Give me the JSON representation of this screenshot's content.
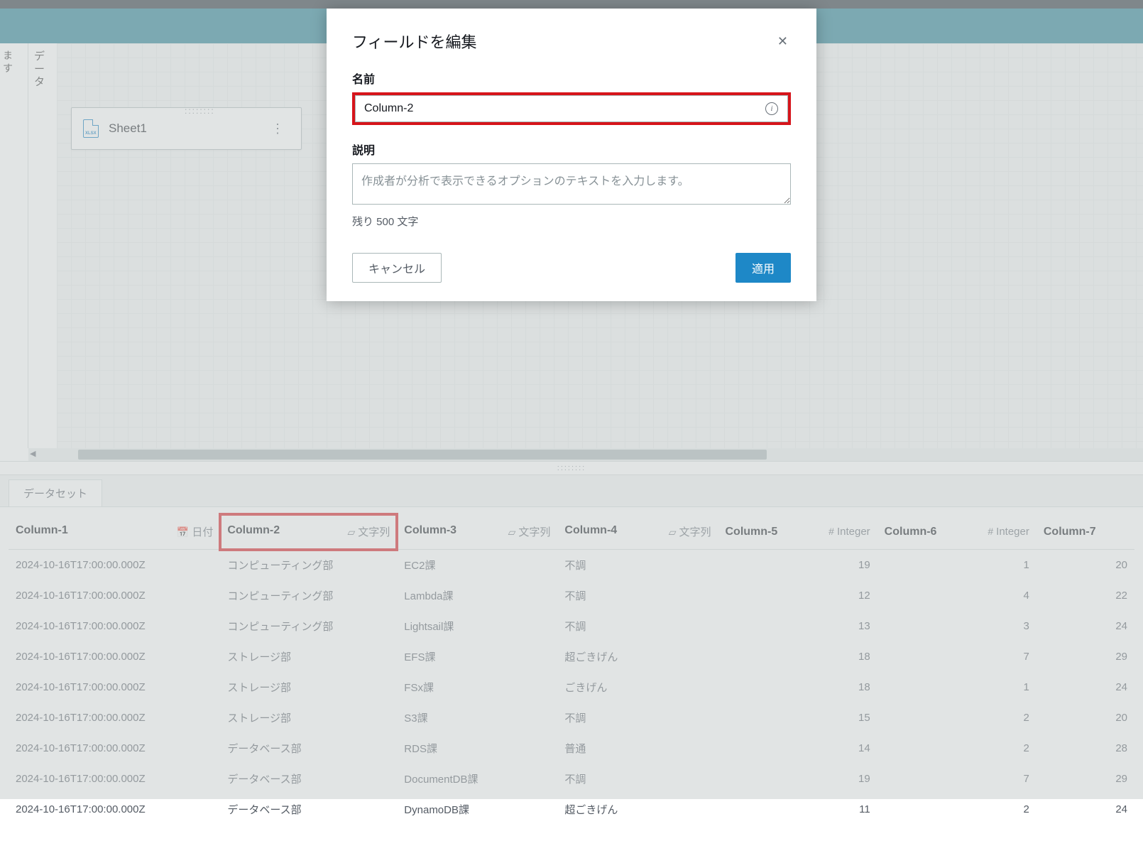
{
  "sidebar_label_ma": "ま\nす",
  "sidebar_label_data": "デー\nタ",
  "sheet": {
    "name": "Sheet1"
  },
  "tab": {
    "dataset": "データセット"
  },
  "columns": [
    {
      "name": "Column-1",
      "type_label": "日付",
      "icon": "cal"
    },
    {
      "name": "Column-2",
      "type_label": "文字列",
      "icon": "str",
      "highlight": true
    },
    {
      "name": "Column-3",
      "type_label": "文字列",
      "icon": "str"
    },
    {
      "name": "Column-4",
      "type_label": "文字列",
      "icon": "str"
    },
    {
      "name": "Column-5",
      "type_label": "Integer",
      "icon": "int"
    },
    {
      "name": "Column-6",
      "type_label": "Integer",
      "icon": "int"
    },
    {
      "name": "Column-7",
      "type_label": "",
      "icon": ""
    }
  ],
  "rows": [
    [
      "2024-10-16T17:00:00.000Z",
      "コンピューティング部",
      "EC2課",
      "不調",
      "19",
      "1",
      "20"
    ],
    [
      "2024-10-16T17:00:00.000Z",
      "コンピューティング部",
      "Lambda課",
      "不調",
      "12",
      "4",
      "22"
    ],
    [
      "2024-10-16T17:00:00.000Z",
      "コンピューティング部",
      "Lightsail課",
      "不調",
      "13",
      "3",
      "24"
    ],
    [
      "2024-10-16T17:00:00.000Z",
      "ストレージ部",
      "EFS課",
      "超ごきげん",
      "18",
      "7",
      "29"
    ],
    [
      "2024-10-16T17:00:00.000Z",
      "ストレージ部",
      "FSx課",
      "ごきげん",
      "18",
      "1",
      "24"
    ],
    [
      "2024-10-16T17:00:00.000Z",
      "ストレージ部",
      "S3課",
      "不調",
      "15",
      "2",
      "20"
    ],
    [
      "2024-10-16T17:00:00.000Z",
      "データベース部",
      "RDS課",
      "普通",
      "14",
      "2",
      "28"
    ],
    [
      "2024-10-16T17:00:00.000Z",
      "データベース部",
      "DocumentDB課",
      "不調",
      "19",
      "7",
      "29"
    ],
    [
      "2024-10-16T17:00:00.000Z",
      "データベース部",
      "DynamoDB課",
      "超ごきげん",
      "11",
      "2",
      "24"
    ]
  ],
  "modal": {
    "title": "フィールドを編集",
    "name_label": "名前",
    "name_value": "Column-2",
    "desc_label": "説明",
    "desc_placeholder": "作成者が分析で表示できるオプションのテキストを入力します。",
    "char_count": "残り 500 文字",
    "cancel": "キャンセル",
    "apply": "適用"
  }
}
